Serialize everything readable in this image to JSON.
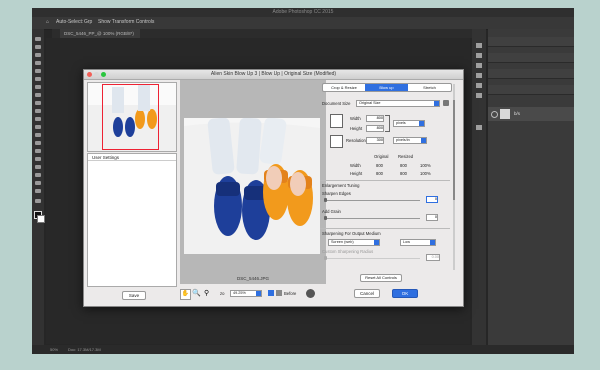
{
  "app": {
    "title": "Adobe Photoshop CC 2015",
    "tab_label": "DSC_5446_PP_@ 100% (RGB/8*)",
    "options_bar": [
      "Auto-Select:",
      "Grp",
      "Show Transform Controls"
    ],
    "layer_name": "b/s",
    "status_left": "50%",
    "status_doc": "Doc: 17.3M/17.3M"
  },
  "dialog": {
    "title": "Alien Skin Blow Up 3 | Blow Up | Original Size (Modified)",
    "user_settings": "User Settings",
    "filename": "DSC_5446.JPG",
    "save": "Save",
    "zoom_label": "zo",
    "zoom_value": "49.25%",
    "before_label": "Before",
    "tabs": [
      "Crop & Resize",
      "Blow up",
      "Stretch"
    ],
    "active_tab": 1,
    "document_size_label": "Document Size",
    "document_size_value": "Original Size",
    "width_label": "Width",
    "width_value": "800",
    "height_label": "Height",
    "height_value": "800",
    "size_unit": "pixels",
    "resolution_label": "Resolution",
    "resolution_value": "300",
    "resolution_unit": "pixels/in",
    "original_header": "Original",
    "resized_header": "Resized",
    "rows": [
      {
        "label": "Width",
        "original": "800",
        "resized": "800",
        "pct": "100%"
      },
      {
        "label": "Height",
        "original": "800",
        "resized": "800",
        "pct": "100%"
      }
    ],
    "enlargement_tuning": "Enlargement Tuning",
    "sharpen_edges_label": "Sharpen Edges",
    "sharpen_edges_value": "0",
    "add_grain_label": "Add Grain",
    "add_grain_value": "0",
    "sharpening_output_label": "Sharpening For Output Medium",
    "sharpening_medium": "Screen (web)",
    "sharpening_amount": "Low",
    "custom_radius_label": "Custom Sharpening Radius",
    "custom_radius_value": "0.00",
    "reset_all": "Reset All Controls",
    "cancel": "Cancel",
    "ok": "OK"
  },
  "colors": {
    "accent": "#2f6fe0",
    "slipper_blue": "#1e3f9a",
    "slipper_orange": "#f29a1c",
    "background": "#b9d2cd"
  }
}
